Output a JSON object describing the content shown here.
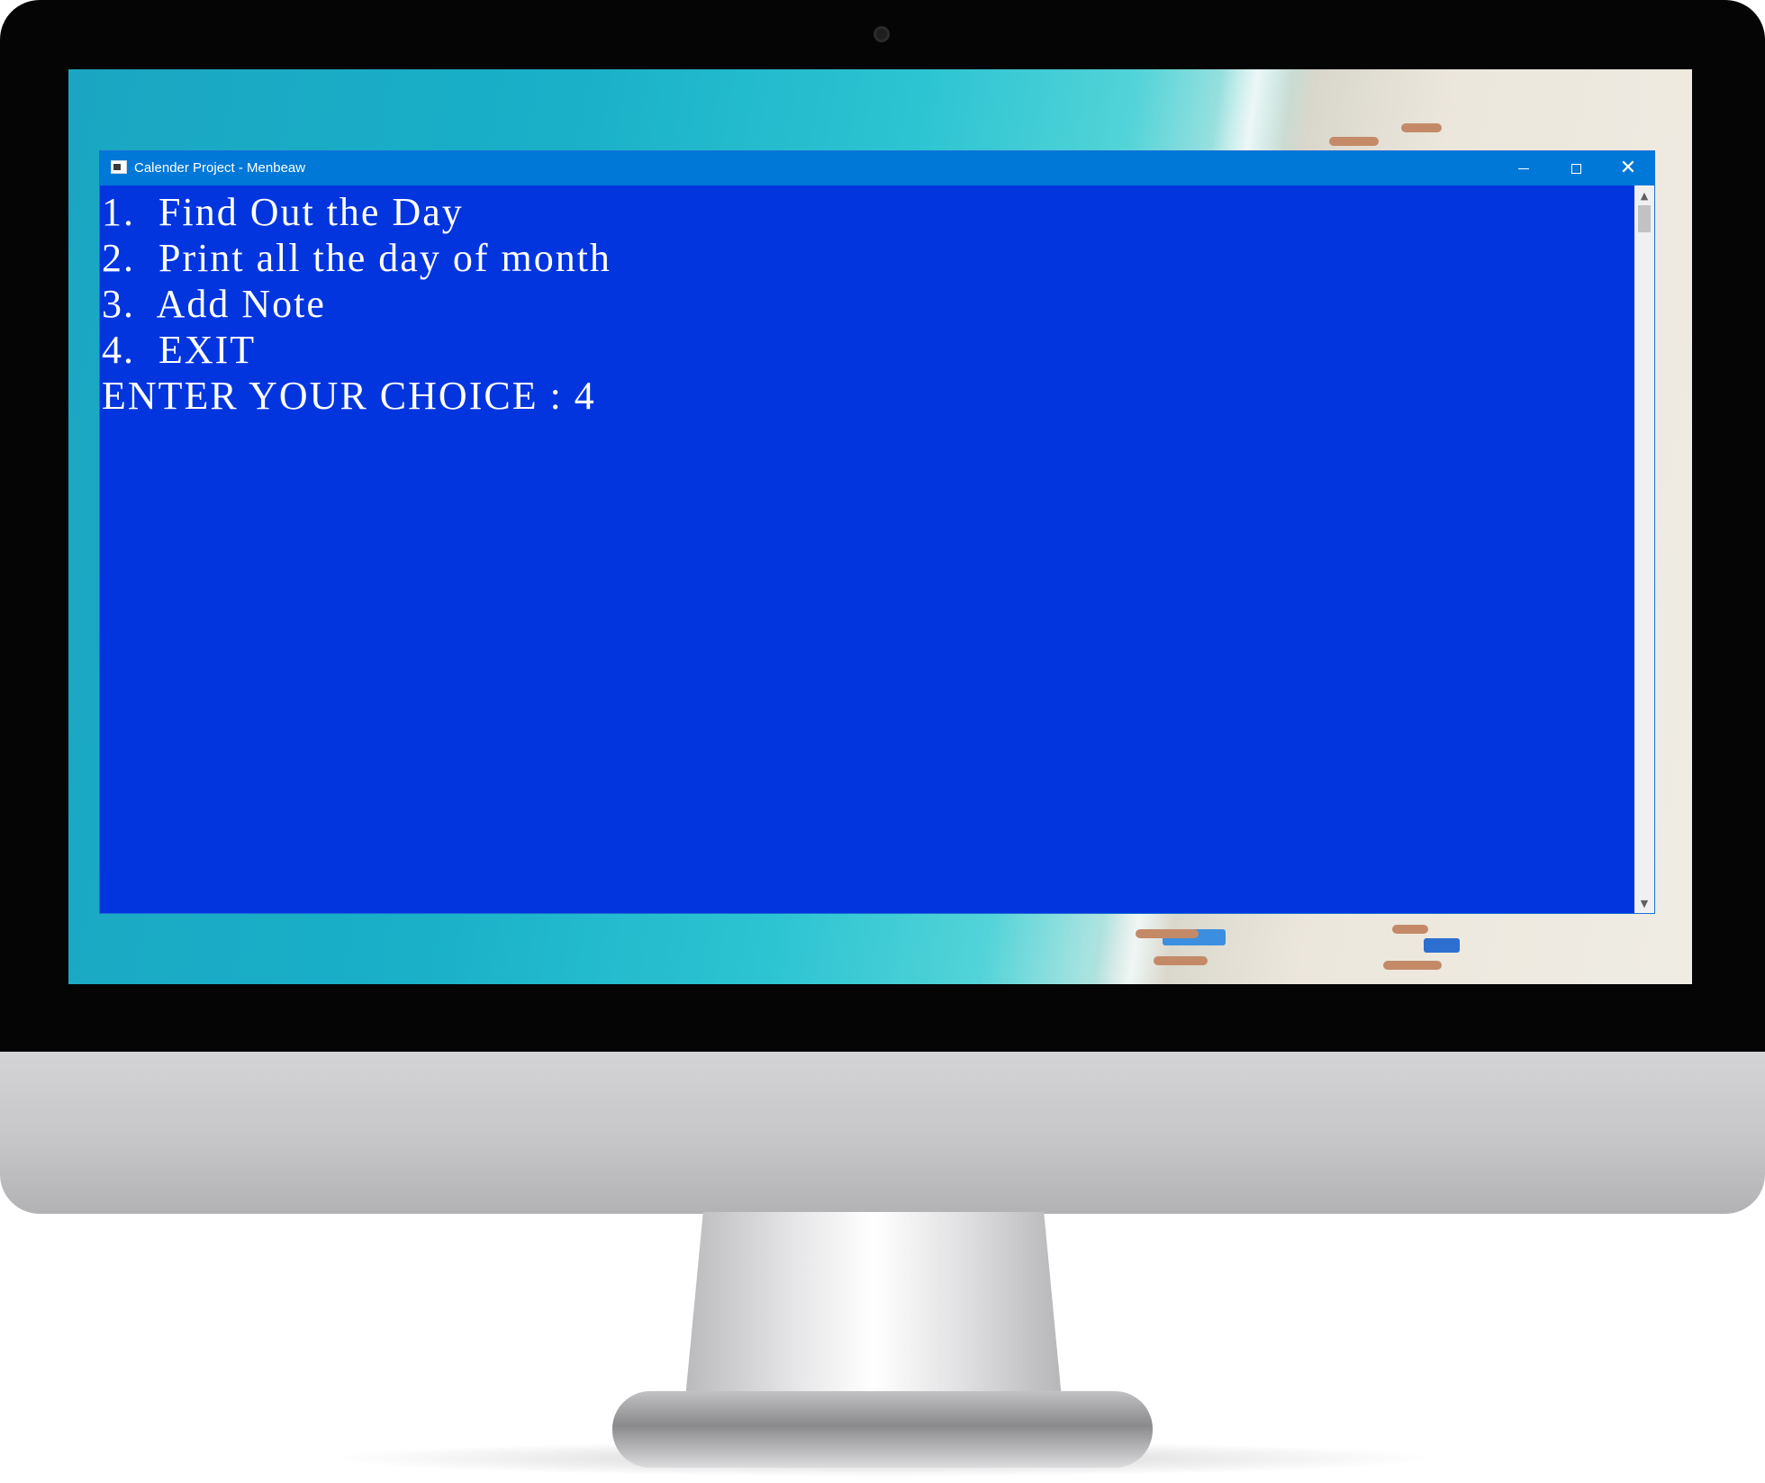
{
  "window": {
    "title": "Calender Project - Menbeaw",
    "minimize_icon": "minimize-icon",
    "maximize_icon": "maximize-icon",
    "close_icon": "close-icon"
  },
  "console": {
    "background": "#0335df",
    "text_color": "#ffffff",
    "lines": [
      "1.  Find Out the Day",
      "2.  Print all the day of month",
      "3.  Add Note",
      "4.  EXIT",
      "ENTER YOUR CHOICE : 4"
    ]
  },
  "colors": {
    "titlebar": "#0078d7",
    "bezel": "#050505"
  }
}
